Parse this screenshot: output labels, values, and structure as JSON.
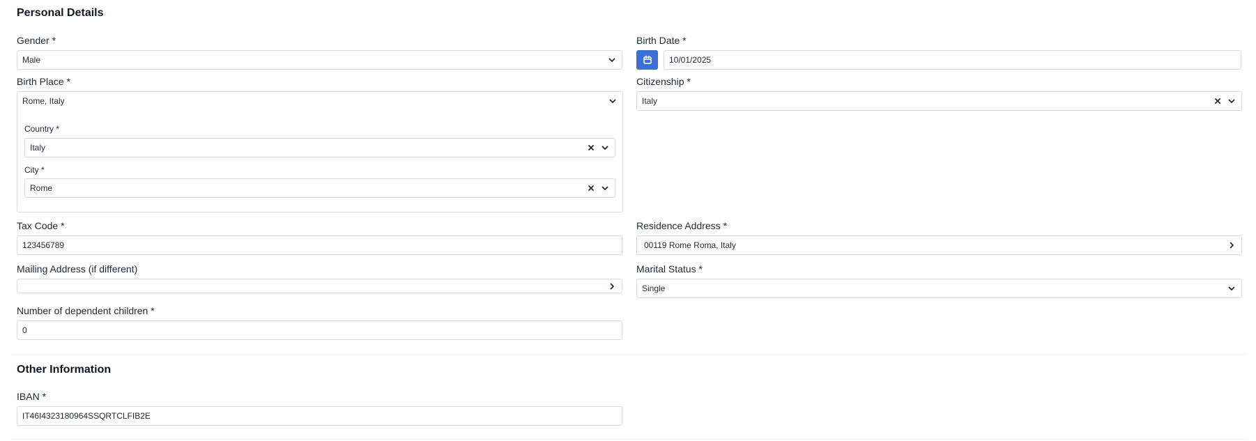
{
  "sections": {
    "personal": "Personal Details",
    "other": "Other Information"
  },
  "fields": {
    "gender": {
      "label": "Gender *",
      "value": "Male"
    },
    "birth_date": {
      "label": "Birth Date *",
      "value": "10/01/2025"
    },
    "birth_place": {
      "label": "Birth Place *",
      "value": "Rome, Italy",
      "country": {
        "label": "Country *",
        "value": "Italy"
      },
      "city": {
        "label": "City *",
        "value": "Rome"
      }
    },
    "citizenship": {
      "label": "Citizenship *",
      "value": "Italy"
    },
    "tax_code": {
      "label": "Tax Code *",
      "value": "123456789"
    },
    "residence_address": {
      "label": "Residence Address *",
      "value": "00119 Rome Roma, Italy"
    },
    "mailing_address": {
      "label": "Mailing Address (if different)",
      "value": ""
    },
    "marital_status": {
      "label": "Marital Status *",
      "value": "Single"
    },
    "dependent_children": {
      "label": "Number of dependent children *",
      "value": "0"
    },
    "iban": {
      "label": "IBAN *",
      "value": "IT46I4323180964SSQRTCLFIB2E"
    }
  }
}
